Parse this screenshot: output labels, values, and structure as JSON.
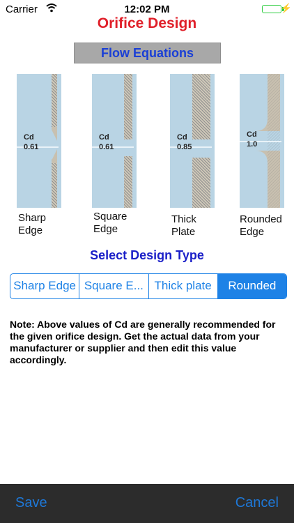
{
  "status": {
    "carrier": "Carrier",
    "time": "12:02 PM"
  },
  "title": "Orifice Design",
  "flow_button": "Flow Equations",
  "diagrams": [
    {
      "cd_label": "Cd",
      "cd_value": "0.61",
      "line1": "Sharp",
      "line2": "Edge"
    },
    {
      "cd_label": "Cd",
      "cd_value": "0.61",
      "line1": "Square",
      "line2": "Edge"
    },
    {
      "cd_label": "Cd",
      "cd_value": "0.85",
      "line1": "Thick",
      "line2": "Plate"
    },
    {
      "cd_label": "Cd",
      "cd_value": "1.0",
      "line1": "Rounded",
      "line2": "Edge"
    }
  ],
  "select_title": "Select Design Type",
  "segments": [
    "Sharp Edge",
    "Square E...",
    "Thick plate",
    "Rounded"
  ],
  "selected_segment": "Rounded",
  "note": "Note: Above values of Cd are generally recommended for the given orifice design.  Get the actual data from your manufacturer or supplier and then edit this value accordingly.",
  "toolbar": {
    "save": "Save",
    "cancel": "Cancel"
  },
  "colors": {
    "title": "#e0202a",
    "accent": "#1e82e6",
    "select_title": "#1a1fc8"
  }
}
